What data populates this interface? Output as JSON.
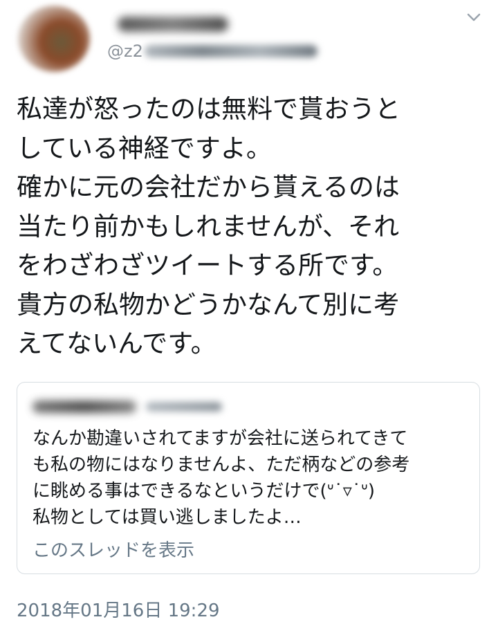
{
  "author": {
    "handle_prefix": "@z2"
  },
  "tweet": {
    "text": "私達が怒ったのは無料で貰おうと\nしている神経ですよ。\n確かに元の会社だから貰えるのは\n当たり前かもしれませんが、それ\nをわざわざツイートする所です。\n貴方の私物かどうかなんて別に考\nえてないんです。"
  },
  "quoted_tweet": {
    "text": "なんか勘違いされてますが会社に送られてきて\nも私の物にはなりませんよ、ただ柄などの参考\nに眺める事はできるなというだけで(ᐡ˙▿˙ᐡ)\n私物としては買い逃しましたよ…",
    "show_thread_label": "このスレッドを表示"
  },
  "timestamp": "2018年01月16日 19:29",
  "colors": {
    "text": "#14171a",
    "secondary": "#657786",
    "border": "#d7dde2"
  },
  "icons": {
    "menu": "chevron-down-icon"
  }
}
